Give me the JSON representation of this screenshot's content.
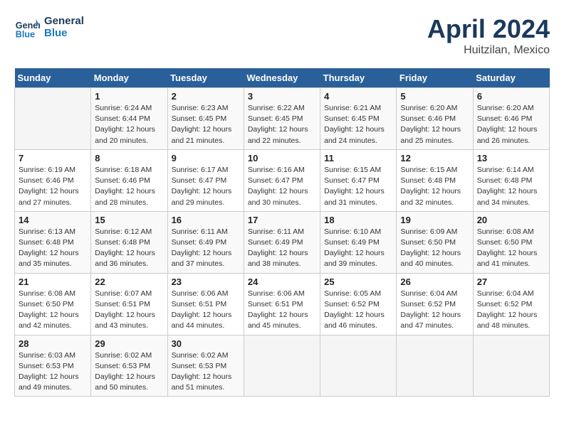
{
  "header": {
    "logo_line1": "General",
    "logo_line2": "Blue",
    "title": "April 2024",
    "subtitle": "Huitzilan, Mexico"
  },
  "days_of_week": [
    "Sunday",
    "Monday",
    "Tuesday",
    "Wednesday",
    "Thursday",
    "Friday",
    "Saturday"
  ],
  "weeks": [
    [
      {
        "day": "",
        "sunrise": "",
        "sunset": "",
        "daylight": ""
      },
      {
        "day": "1",
        "sunrise": "Sunrise: 6:24 AM",
        "sunset": "Sunset: 6:44 PM",
        "daylight": "Daylight: 12 hours and 20 minutes."
      },
      {
        "day": "2",
        "sunrise": "Sunrise: 6:23 AM",
        "sunset": "Sunset: 6:45 PM",
        "daylight": "Daylight: 12 hours and 21 minutes."
      },
      {
        "day": "3",
        "sunrise": "Sunrise: 6:22 AM",
        "sunset": "Sunset: 6:45 PM",
        "daylight": "Daylight: 12 hours and 22 minutes."
      },
      {
        "day": "4",
        "sunrise": "Sunrise: 6:21 AM",
        "sunset": "Sunset: 6:45 PM",
        "daylight": "Daylight: 12 hours and 24 minutes."
      },
      {
        "day": "5",
        "sunrise": "Sunrise: 6:20 AM",
        "sunset": "Sunset: 6:46 PM",
        "daylight": "Daylight: 12 hours and 25 minutes."
      },
      {
        "day": "6",
        "sunrise": "Sunrise: 6:20 AM",
        "sunset": "Sunset: 6:46 PM",
        "daylight": "Daylight: 12 hours and 26 minutes."
      }
    ],
    [
      {
        "day": "7",
        "sunrise": "Sunrise: 6:19 AM",
        "sunset": "Sunset: 6:46 PM",
        "daylight": "Daylight: 12 hours and 27 minutes."
      },
      {
        "day": "8",
        "sunrise": "Sunrise: 6:18 AM",
        "sunset": "Sunset: 6:46 PM",
        "daylight": "Daylight: 12 hours and 28 minutes."
      },
      {
        "day": "9",
        "sunrise": "Sunrise: 6:17 AM",
        "sunset": "Sunset: 6:47 PM",
        "daylight": "Daylight: 12 hours and 29 minutes."
      },
      {
        "day": "10",
        "sunrise": "Sunrise: 6:16 AM",
        "sunset": "Sunset: 6:47 PM",
        "daylight": "Daylight: 12 hours and 30 minutes."
      },
      {
        "day": "11",
        "sunrise": "Sunrise: 6:15 AM",
        "sunset": "Sunset: 6:47 PM",
        "daylight": "Daylight: 12 hours and 31 minutes."
      },
      {
        "day": "12",
        "sunrise": "Sunrise: 6:15 AM",
        "sunset": "Sunset: 6:48 PM",
        "daylight": "Daylight: 12 hours and 32 minutes."
      },
      {
        "day": "13",
        "sunrise": "Sunrise: 6:14 AM",
        "sunset": "Sunset: 6:48 PM",
        "daylight": "Daylight: 12 hours and 34 minutes."
      }
    ],
    [
      {
        "day": "14",
        "sunrise": "Sunrise: 6:13 AM",
        "sunset": "Sunset: 6:48 PM",
        "daylight": "Daylight: 12 hours and 35 minutes."
      },
      {
        "day": "15",
        "sunrise": "Sunrise: 6:12 AM",
        "sunset": "Sunset: 6:48 PM",
        "daylight": "Daylight: 12 hours and 36 minutes."
      },
      {
        "day": "16",
        "sunrise": "Sunrise: 6:11 AM",
        "sunset": "Sunset: 6:49 PM",
        "daylight": "Daylight: 12 hours and 37 minutes."
      },
      {
        "day": "17",
        "sunrise": "Sunrise: 6:11 AM",
        "sunset": "Sunset: 6:49 PM",
        "daylight": "Daylight: 12 hours and 38 minutes."
      },
      {
        "day": "18",
        "sunrise": "Sunrise: 6:10 AM",
        "sunset": "Sunset: 6:49 PM",
        "daylight": "Daylight: 12 hours and 39 minutes."
      },
      {
        "day": "19",
        "sunrise": "Sunrise: 6:09 AM",
        "sunset": "Sunset: 6:50 PM",
        "daylight": "Daylight: 12 hours and 40 minutes."
      },
      {
        "day": "20",
        "sunrise": "Sunrise: 6:08 AM",
        "sunset": "Sunset: 6:50 PM",
        "daylight": "Daylight: 12 hours and 41 minutes."
      }
    ],
    [
      {
        "day": "21",
        "sunrise": "Sunrise: 6:08 AM",
        "sunset": "Sunset: 6:50 PM",
        "daylight": "Daylight: 12 hours and 42 minutes."
      },
      {
        "day": "22",
        "sunrise": "Sunrise: 6:07 AM",
        "sunset": "Sunset: 6:51 PM",
        "daylight": "Daylight: 12 hours and 43 minutes."
      },
      {
        "day": "23",
        "sunrise": "Sunrise: 6:06 AM",
        "sunset": "Sunset: 6:51 PM",
        "daylight": "Daylight: 12 hours and 44 minutes."
      },
      {
        "day": "24",
        "sunrise": "Sunrise: 6:06 AM",
        "sunset": "Sunset: 6:51 PM",
        "daylight": "Daylight: 12 hours and 45 minutes."
      },
      {
        "day": "25",
        "sunrise": "Sunrise: 6:05 AM",
        "sunset": "Sunset: 6:52 PM",
        "daylight": "Daylight: 12 hours and 46 minutes."
      },
      {
        "day": "26",
        "sunrise": "Sunrise: 6:04 AM",
        "sunset": "Sunset: 6:52 PM",
        "daylight": "Daylight: 12 hours and 47 minutes."
      },
      {
        "day": "27",
        "sunrise": "Sunrise: 6:04 AM",
        "sunset": "Sunset: 6:52 PM",
        "daylight": "Daylight: 12 hours and 48 minutes."
      }
    ],
    [
      {
        "day": "28",
        "sunrise": "Sunrise: 6:03 AM",
        "sunset": "Sunset: 6:53 PM",
        "daylight": "Daylight: 12 hours and 49 minutes."
      },
      {
        "day": "29",
        "sunrise": "Sunrise: 6:02 AM",
        "sunset": "Sunset: 6:53 PM",
        "daylight": "Daylight: 12 hours and 50 minutes."
      },
      {
        "day": "30",
        "sunrise": "Sunrise: 6:02 AM",
        "sunset": "Sunset: 6:53 PM",
        "daylight": "Daylight: 12 hours and 51 minutes."
      },
      {
        "day": "",
        "sunrise": "",
        "sunset": "",
        "daylight": ""
      },
      {
        "day": "",
        "sunrise": "",
        "sunset": "",
        "daylight": ""
      },
      {
        "day": "",
        "sunrise": "",
        "sunset": "",
        "daylight": ""
      },
      {
        "day": "",
        "sunrise": "",
        "sunset": "",
        "daylight": ""
      }
    ]
  ]
}
